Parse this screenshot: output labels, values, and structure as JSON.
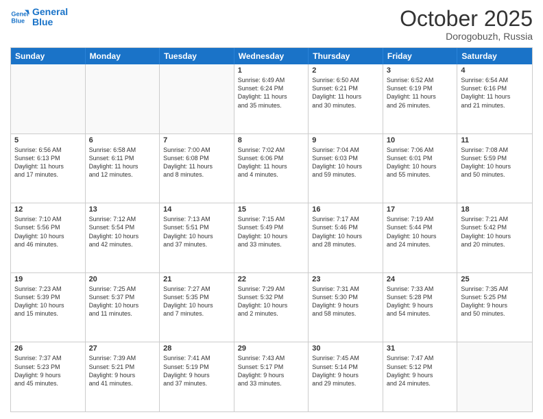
{
  "header": {
    "logo_line1": "General",
    "logo_line2": "Blue",
    "month": "October 2025",
    "location": "Dorogobuzh, Russia"
  },
  "weekdays": [
    "Sunday",
    "Monday",
    "Tuesday",
    "Wednesday",
    "Thursday",
    "Friday",
    "Saturday"
  ],
  "rows": [
    [
      {
        "day": "",
        "text": ""
      },
      {
        "day": "",
        "text": ""
      },
      {
        "day": "",
        "text": ""
      },
      {
        "day": "1",
        "text": "Sunrise: 6:49 AM\nSunset: 6:24 PM\nDaylight: 11 hours\nand 35 minutes."
      },
      {
        "day": "2",
        "text": "Sunrise: 6:50 AM\nSunset: 6:21 PM\nDaylight: 11 hours\nand 30 minutes."
      },
      {
        "day": "3",
        "text": "Sunrise: 6:52 AM\nSunset: 6:19 PM\nDaylight: 11 hours\nand 26 minutes."
      },
      {
        "day": "4",
        "text": "Sunrise: 6:54 AM\nSunset: 6:16 PM\nDaylight: 11 hours\nand 21 minutes."
      }
    ],
    [
      {
        "day": "5",
        "text": "Sunrise: 6:56 AM\nSunset: 6:13 PM\nDaylight: 11 hours\nand 17 minutes."
      },
      {
        "day": "6",
        "text": "Sunrise: 6:58 AM\nSunset: 6:11 PM\nDaylight: 11 hours\nand 12 minutes."
      },
      {
        "day": "7",
        "text": "Sunrise: 7:00 AM\nSunset: 6:08 PM\nDaylight: 11 hours\nand 8 minutes."
      },
      {
        "day": "8",
        "text": "Sunrise: 7:02 AM\nSunset: 6:06 PM\nDaylight: 11 hours\nand 4 minutes."
      },
      {
        "day": "9",
        "text": "Sunrise: 7:04 AM\nSunset: 6:03 PM\nDaylight: 10 hours\nand 59 minutes."
      },
      {
        "day": "10",
        "text": "Sunrise: 7:06 AM\nSunset: 6:01 PM\nDaylight: 10 hours\nand 55 minutes."
      },
      {
        "day": "11",
        "text": "Sunrise: 7:08 AM\nSunset: 5:59 PM\nDaylight: 10 hours\nand 50 minutes."
      }
    ],
    [
      {
        "day": "12",
        "text": "Sunrise: 7:10 AM\nSunset: 5:56 PM\nDaylight: 10 hours\nand 46 minutes."
      },
      {
        "day": "13",
        "text": "Sunrise: 7:12 AM\nSunset: 5:54 PM\nDaylight: 10 hours\nand 42 minutes."
      },
      {
        "day": "14",
        "text": "Sunrise: 7:13 AM\nSunset: 5:51 PM\nDaylight: 10 hours\nand 37 minutes."
      },
      {
        "day": "15",
        "text": "Sunrise: 7:15 AM\nSunset: 5:49 PM\nDaylight: 10 hours\nand 33 minutes."
      },
      {
        "day": "16",
        "text": "Sunrise: 7:17 AM\nSunset: 5:46 PM\nDaylight: 10 hours\nand 28 minutes."
      },
      {
        "day": "17",
        "text": "Sunrise: 7:19 AM\nSunset: 5:44 PM\nDaylight: 10 hours\nand 24 minutes."
      },
      {
        "day": "18",
        "text": "Sunrise: 7:21 AM\nSunset: 5:42 PM\nDaylight: 10 hours\nand 20 minutes."
      }
    ],
    [
      {
        "day": "19",
        "text": "Sunrise: 7:23 AM\nSunset: 5:39 PM\nDaylight: 10 hours\nand 15 minutes."
      },
      {
        "day": "20",
        "text": "Sunrise: 7:25 AM\nSunset: 5:37 PM\nDaylight: 10 hours\nand 11 minutes."
      },
      {
        "day": "21",
        "text": "Sunrise: 7:27 AM\nSunset: 5:35 PM\nDaylight: 10 hours\nand 7 minutes."
      },
      {
        "day": "22",
        "text": "Sunrise: 7:29 AM\nSunset: 5:32 PM\nDaylight: 10 hours\nand 2 minutes."
      },
      {
        "day": "23",
        "text": "Sunrise: 7:31 AM\nSunset: 5:30 PM\nDaylight: 9 hours\nand 58 minutes."
      },
      {
        "day": "24",
        "text": "Sunrise: 7:33 AM\nSunset: 5:28 PM\nDaylight: 9 hours\nand 54 minutes."
      },
      {
        "day": "25",
        "text": "Sunrise: 7:35 AM\nSunset: 5:25 PM\nDaylight: 9 hours\nand 50 minutes."
      }
    ],
    [
      {
        "day": "26",
        "text": "Sunrise: 7:37 AM\nSunset: 5:23 PM\nDaylight: 9 hours\nand 45 minutes."
      },
      {
        "day": "27",
        "text": "Sunrise: 7:39 AM\nSunset: 5:21 PM\nDaylight: 9 hours\nand 41 minutes."
      },
      {
        "day": "28",
        "text": "Sunrise: 7:41 AM\nSunset: 5:19 PM\nDaylight: 9 hours\nand 37 minutes."
      },
      {
        "day": "29",
        "text": "Sunrise: 7:43 AM\nSunset: 5:17 PM\nDaylight: 9 hours\nand 33 minutes."
      },
      {
        "day": "30",
        "text": "Sunrise: 7:45 AM\nSunset: 5:14 PM\nDaylight: 9 hours\nand 29 minutes."
      },
      {
        "day": "31",
        "text": "Sunrise: 7:47 AM\nSunset: 5:12 PM\nDaylight: 9 hours\nand 24 minutes."
      },
      {
        "day": "",
        "text": ""
      }
    ]
  ]
}
